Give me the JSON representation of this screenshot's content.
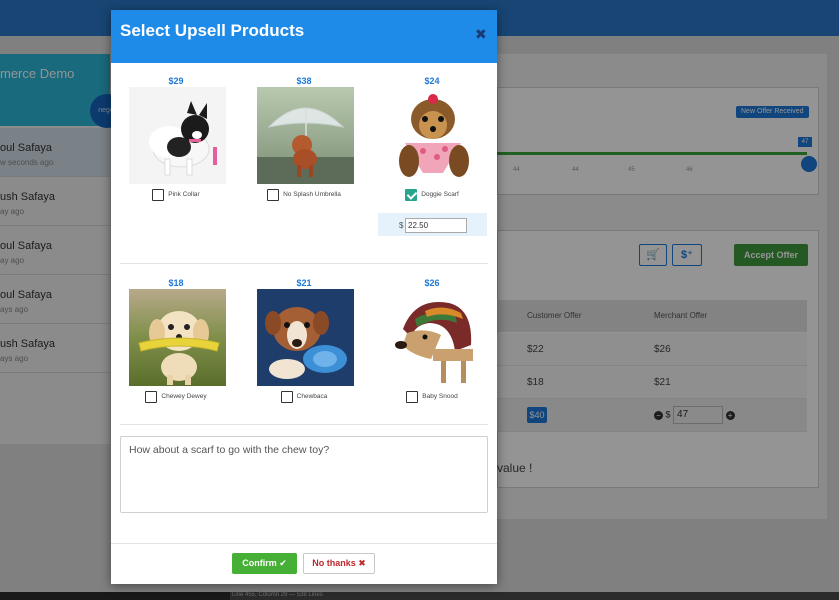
{
  "background": {
    "store_title": "merce Demo",
    "store_badge": "negot",
    "conversations": [
      {
        "name": "oul Safaya",
        "time": "w seconds ago"
      },
      {
        "name": "ush Safaya",
        "time": "ay ago"
      },
      {
        "name": "oul Safaya",
        "time": "ay ago"
      },
      {
        "name": "oul Safaya",
        "time": "ays ago"
      },
      {
        "name": "ush Safaya",
        "time": "ays ago"
      }
    ],
    "offer_badge": "New Offer Received",
    "slider_value": "47",
    "slider_ticks": [
      "44",
      "44",
      "45",
      "46"
    ],
    "cart_icon_glyph": "🛒",
    "dollar_icon_glyph": "$⁺",
    "accept_label": "Accept Offer",
    "table_headers": [
      "Customer Offer",
      "Merchant Offer"
    ],
    "table_rows": [
      {
        "customer": "$22",
        "merchant": "$26"
      },
      {
        "customer": "$18",
        "merchant": "$21"
      }
    ],
    "current_offer": "$40",
    "counter_currency": "$",
    "counter_value": "47",
    "minus_glyph": "−",
    "plus_glyph": "+",
    "value_text": "value !",
    "status_text": "Line 455, Column 29 — 538 Lines"
  },
  "modal": {
    "title": "Select Upsell Products",
    "close_glyph": "✖",
    "products": [
      {
        "price": "$29",
        "label": "Pink Collar",
        "checked": false
      },
      {
        "price": "$38",
        "label": "No Splash Umbrella",
        "checked": false
      },
      {
        "price": "$24",
        "label": "Doggie Scarf",
        "checked": true
      },
      {
        "price": "$18",
        "label": "Chewey Dewey",
        "checked": false
      },
      {
        "price": "$21",
        "label": "Chewbaca",
        "checked": false
      },
      {
        "price": "$26",
        "label": "Baby Snood",
        "checked": false
      }
    ],
    "price_currency": "$",
    "price_value": "22.50",
    "message": "How about a scarf to go with the chew toy?",
    "confirm_label": "Confirm ✔",
    "no_thanks_label": "No thanks ✖"
  },
  "colors": {
    "modal_header": "#1e8be8",
    "price": "#1e78d7",
    "confirm": "#45b035",
    "no_thanks_text": "#c0272d",
    "checked": "#27a58c"
  }
}
